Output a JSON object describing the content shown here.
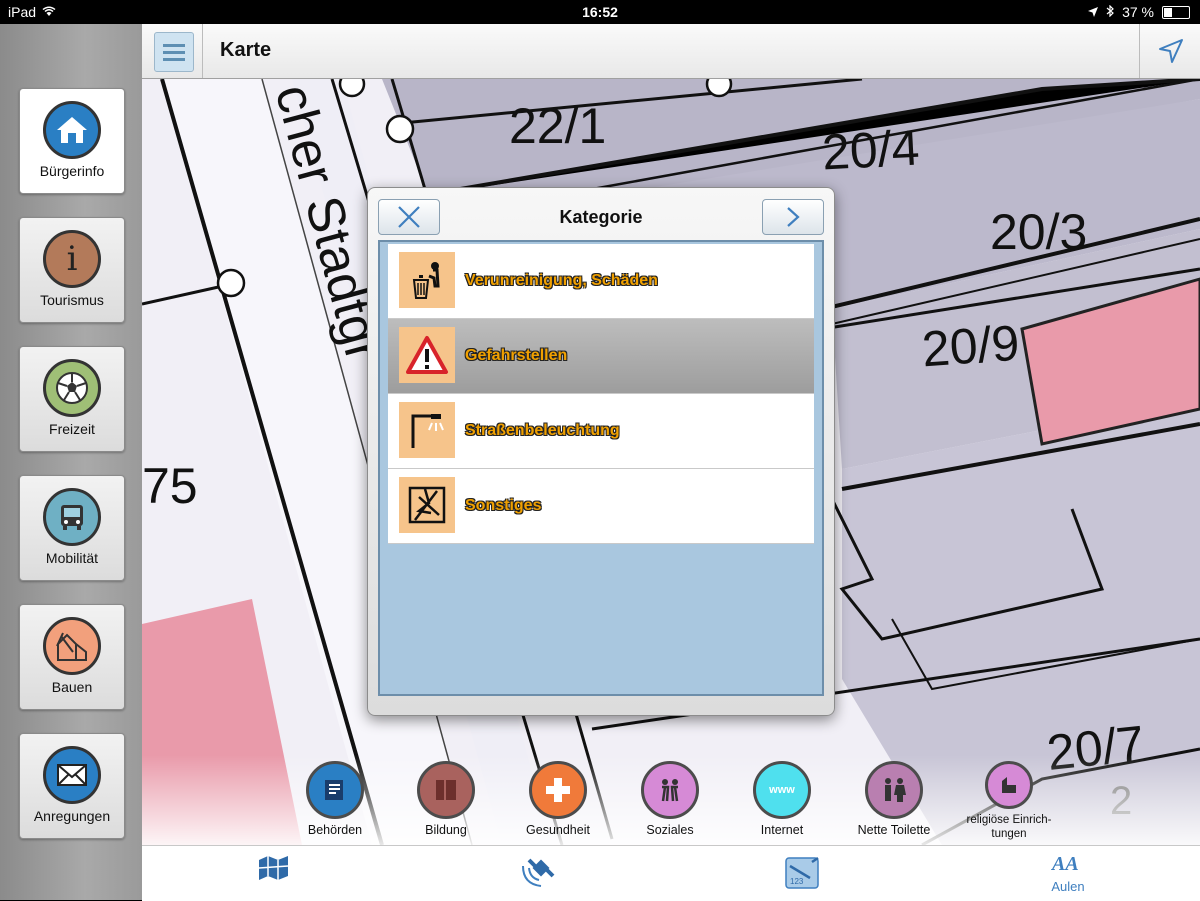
{
  "status_bar": {
    "device": "iPad",
    "time": "16:52",
    "battery": "37 %",
    "battery_level": 0.37
  },
  "top_bar": {
    "title": "Karte"
  },
  "sidebar": {
    "items": [
      {
        "label": "Bürgerinfo",
        "icon": "home-icon",
        "color": "#2a7fc4"
      },
      {
        "label": "Tourismus",
        "icon": "info-icon",
        "color": "#b37a5a"
      },
      {
        "label": "Freizeit",
        "icon": "ball-icon",
        "color": "#8fb06a"
      },
      {
        "label": "Mobilität",
        "icon": "bus-icon",
        "color": "#5d9fb5"
      },
      {
        "label": "Bauen",
        "icon": "building-icon",
        "color": "#e8845a"
      },
      {
        "label": "Anregungen",
        "icon": "mail-icon",
        "color": "#2a7fc4"
      }
    ]
  },
  "map": {
    "labels": [
      "22/1",
      "20/4",
      "20/3",
      "20/9",
      "20/7",
      "2",
      "75",
      "cher Stadtgr"
    ]
  },
  "dialog": {
    "title": "Kategorie",
    "items": [
      {
        "label": "Verunreinigung, Schäden",
        "icon": "trash-icon",
        "selected": false
      },
      {
        "label": "Gefahrstellen",
        "icon": "warning-icon",
        "selected": true
      },
      {
        "label": "Straßenbeleuchtung",
        "icon": "streetlight-icon",
        "selected": false
      },
      {
        "label": "Sonstiges",
        "icon": "misc-icon",
        "selected": false
      }
    ]
  },
  "categories": [
    {
      "label": "Behörden",
      "color": "#2a7fc4"
    },
    {
      "label": "Bildung",
      "color": "#a9625e"
    },
    {
      "label": "Gesundheit",
      "color": "#f07a3a"
    },
    {
      "label": "Soziales",
      "color": "#d68ad6"
    },
    {
      "label": "Internet",
      "color": "#4fe0ee"
    },
    {
      "label": "Nette Toilette",
      "color": "#b97fb0"
    },
    {
      "label": "religiöse Einrich-tungen",
      "color": "#d68ad6"
    }
  ],
  "bottom_bar": {
    "items": [
      {
        "label": "",
        "icon": "map-icon"
      },
      {
        "label": "",
        "icon": "satellite-icon"
      },
      {
        "label": "",
        "icon": "report-icon"
      },
      {
        "label": "Aulen",
        "icon": "aulen-icon"
      }
    ]
  }
}
